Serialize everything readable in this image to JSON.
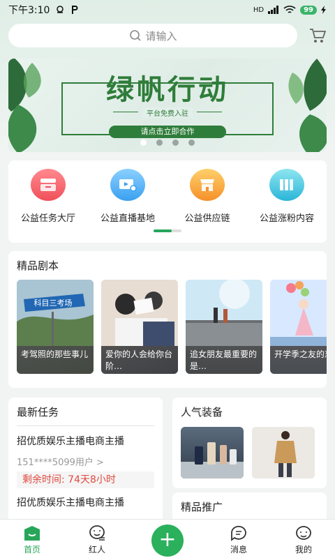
{
  "status_bar": {
    "time": "下午3:10",
    "network": "HD",
    "battery": "99"
  },
  "search": {
    "placeholder": "请输入"
  },
  "banner": {
    "title": "绿帆行动",
    "subtitle": "平台免费入驻",
    "cta": "请点击立即合作",
    "slide_count": 4,
    "active_slide": 0
  },
  "quick_links": [
    {
      "label": "公益任务大厅",
      "icon": "task-hall-icon",
      "color": "#f0505a"
    },
    {
      "label": "公益直播基地",
      "icon": "live-base-icon",
      "color": "#3aa0f0"
    },
    {
      "label": "公益供应链",
      "icon": "supply-chain-icon",
      "color": "#f5902a"
    },
    {
      "label": "公益涨粉内容",
      "icon": "content-icon",
      "color": "#2ab5d8"
    }
  ],
  "scripts": {
    "title": "精品剧本",
    "items": [
      {
        "caption": "考驾照的那些事儿",
        "sign": "科目三考场"
      },
      {
        "caption": "爱你的人会给你台阶…"
      },
      {
        "caption": "追女朋友最重要的是…"
      },
      {
        "caption": "开学季之友的恋爱"
      }
    ]
  },
  "tasks": {
    "title": "最新任务",
    "items": [
      {
        "title": "招优质娱乐主播电商主播",
        "user": "151****5099用户 >",
        "remaining": "剩余时间: 74天8小时"
      },
      {
        "title": "招优质娱乐主播电商主播"
      }
    ]
  },
  "equipment": {
    "title": "人气装备"
  },
  "promotion": {
    "title": "精品推广"
  },
  "tabbar": {
    "items": [
      {
        "label": "首页",
        "icon": "home-icon",
        "active": true
      },
      {
        "label": "红人",
        "icon": "influencer-icon",
        "active": false
      },
      {
        "label": "",
        "icon": "plus-icon",
        "active": false
      },
      {
        "label": "消息",
        "icon": "message-icon",
        "active": false
      },
      {
        "label": "我的",
        "icon": "profile-icon",
        "active": false
      }
    ]
  },
  "colors": {
    "accent": "#27a65a",
    "banner_green": "#2f7d3a",
    "warning": "#e04a3f"
  }
}
